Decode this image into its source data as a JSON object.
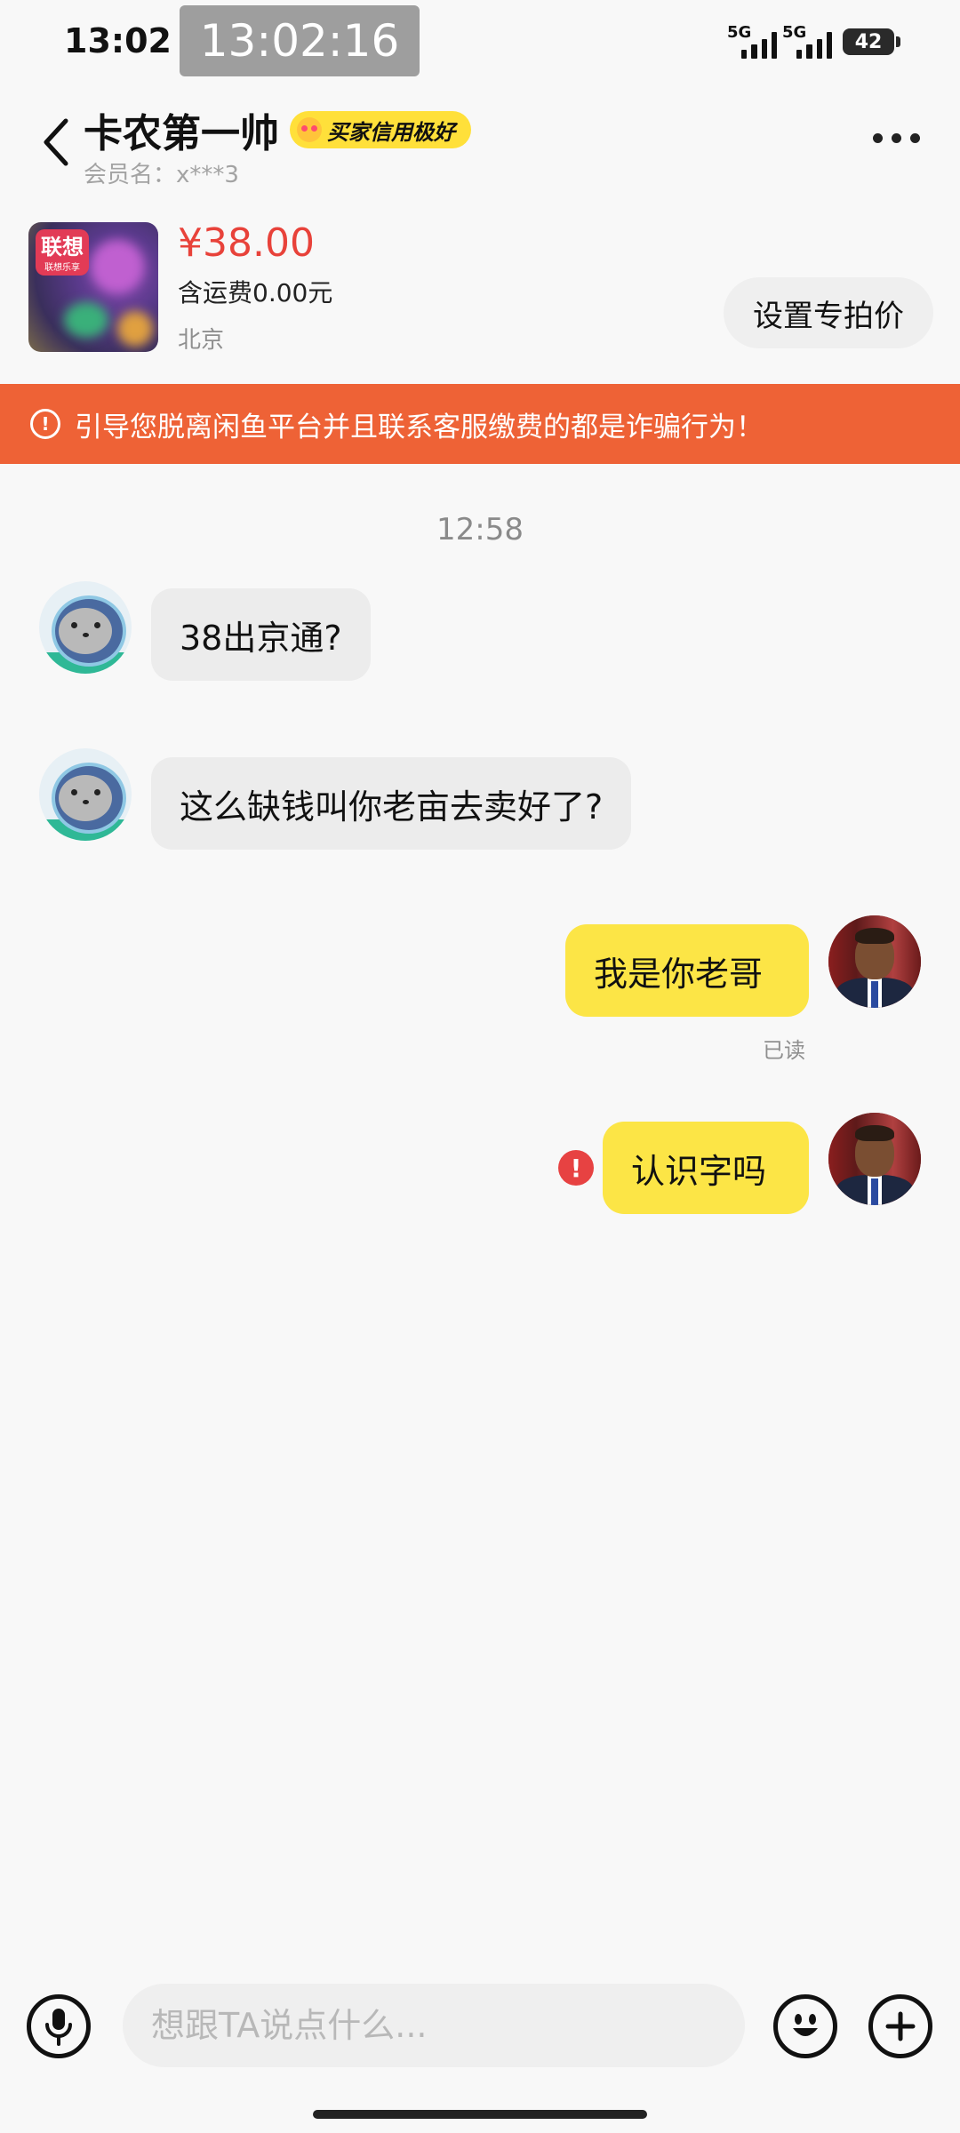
{
  "status_bar": {
    "time": "13:02",
    "clock_overlay": "13:02:16",
    "signal_1_label": "5G",
    "signal_2_label": "5G",
    "battery": "42"
  },
  "header": {
    "nickname": "卡农第一帅",
    "credit_badge": "买家信用极好",
    "member_name": "会员名：x***3"
  },
  "product": {
    "thumb_logo": "联想",
    "thumb_logo_sub": "联想乐享",
    "price": "¥38.00",
    "shipping": "含运费0.00元",
    "location": "北京",
    "special_price_button": "设置专拍价"
  },
  "warning": {
    "text": "引导您脱离闲鱼平台并且联系客服缴费的都是诈骗行为！"
  },
  "chat": {
    "timestamp": "12:58",
    "messages": [
      {
        "from": "other",
        "text": "38出京通?"
      },
      {
        "from": "other",
        "text": "这么缺钱叫你老亩去卖好了?"
      },
      {
        "from": "me",
        "text": "我是你老哥",
        "status": "已读"
      },
      {
        "from": "me",
        "text": "认识字吗",
        "status": "failed"
      }
    ]
  },
  "input_bar": {
    "placeholder": "想跟TA说点什么..."
  },
  "colors": {
    "accent_yellow": "#fce546",
    "warning_orange": "#ee6236",
    "price_red": "#e8423a",
    "error_red": "#e74242"
  },
  "icons": {
    "back": "chevron-left-icon",
    "more": "more-dots-icon",
    "voice": "microphone-icon",
    "emoji": "emoji-icon",
    "add": "plus-icon",
    "warn": "exclamation-icon"
  }
}
